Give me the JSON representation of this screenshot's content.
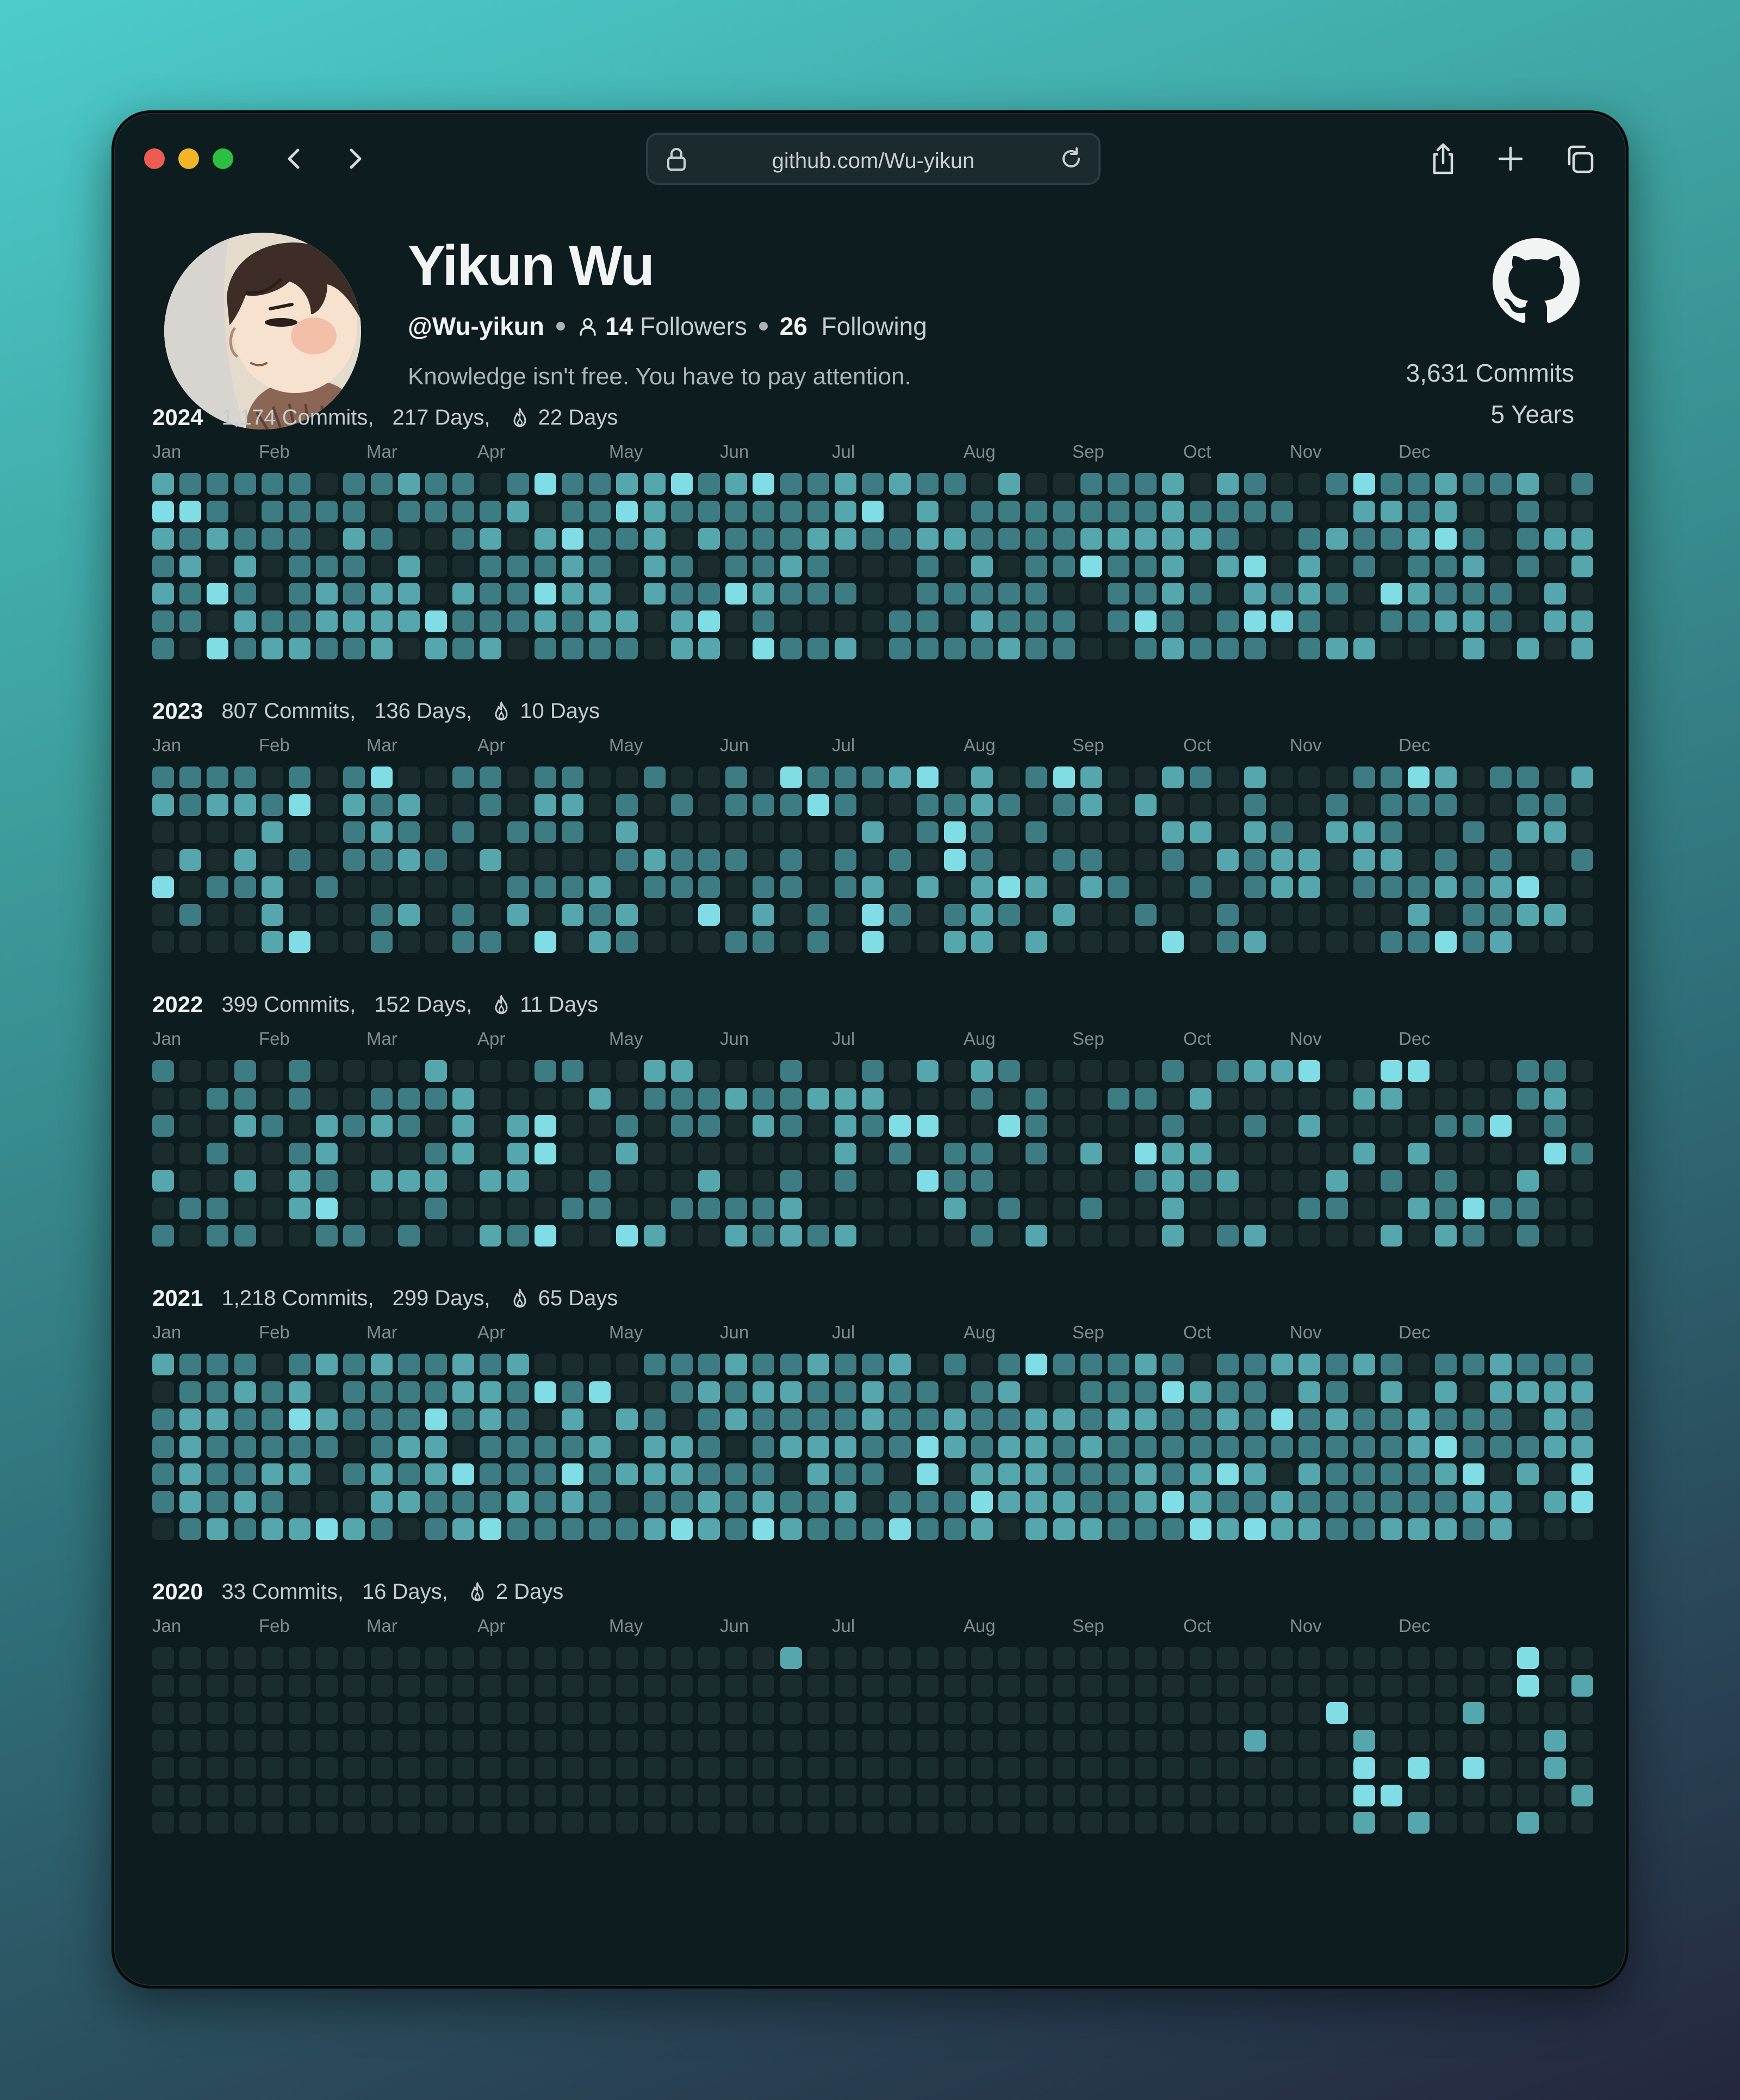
{
  "browser": {
    "url": "github.com/Wu-yikun",
    "back_icon": "chevron-left-icon",
    "forward_icon": "chevron-right-icon",
    "lock_icon": "lock-icon",
    "reload_icon": "reload-icon",
    "share_icon": "share-icon",
    "new_tab_icon": "plus-icon",
    "tabs_icon": "tabs-icon"
  },
  "profile": {
    "name": "Yikun Wu",
    "handle": "@Wu-yikun",
    "followers_count": "14",
    "followers_label": "Followers",
    "following_count": "26",
    "following_label": "Following",
    "bio": "Knowledge isn't free. You have to pay attention.",
    "total_commits": "3,631 Commits",
    "total_years": "5 Years"
  },
  "month_labels": [
    "Jan",
    "Feb",
    "Mar",
    "Apr",
    "May",
    "Jun",
    "Jul",
    "Aug",
    "Sep",
    "Oct",
    "Nov",
    "Dec"
  ],
  "level_colors": [
    "#1b2c2f",
    "#2f5257",
    "#3e7c83",
    "#56a6ae",
    "#80dde6"
  ],
  "years": [
    {
      "year": "2024",
      "commits": "1,174 Commits,",
      "days": "217 Days,",
      "streak": "22 Days"
    },
    {
      "year": "2023",
      "commits": "807 Commits,",
      "days": "136 Days,",
      "streak": "10 Days"
    },
    {
      "year": "2022",
      "commits": "399 Commits,",
      "days": "152 Days,",
      "streak": "11 Days"
    },
    {
      "year": "2021",
      "commits": "1,218 Commits,",
      "days": "299 Days,",
      "streak": "65 Days"
    },
    {
      "year": "2020",
      "commits": "33 Commits,",
      "days": "16 Days,",
      "streak": "2 Days"
    }
  ]
}
